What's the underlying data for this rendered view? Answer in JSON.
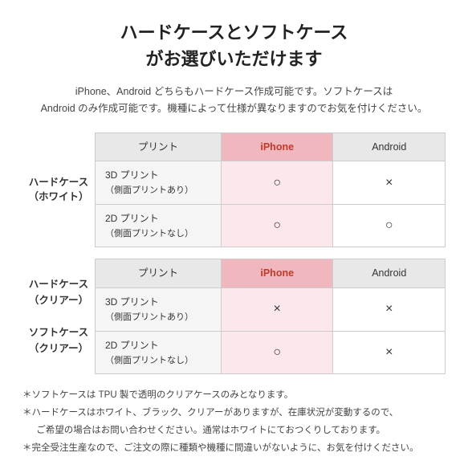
{
  "title_line1": "ハードケースとソフトケース",
  "title_line2": "がお選びいただけます",
  "subtitle": "iPhone、Android どちらもハードケース作成可能です。ソフトケースは\nAndroid のみ作成可能です。機種によって仕様が異なりますのでお気を付けください。",
  "section1": {
    "label_line1": "ハードケース",
    "label_line2": "（ホワイト）",
    "header": {
      "col1": "プリント",
      "col2": "iPhone",
      "col3": "Android"
    },
    "rows": [
      {
        "print": "3D プリント\n（側面プリントあり）",
        "iphone": "○",
        "android": "×"
      },
      {
        "print": "2D プリント\n（側面プリントなし）",
        "iphone": "○",
        "android": "○"
      }
    ]
  },
  "section2": {
    "label_line1": "ハードケース",
    "label_line2": "（クリアー）",
    "label_line3": "ソフトケース",
    "label_line4": "（クリアー）",
    "header": {
      "col1": "プリント",
      "col2": "iPhone",
      "col3": "Android"
    },
    "rows": [
      {
        "print": "3D プリント\n（側面プリントあり）",
        "iphone": "×",
        "android": "×"
      },
      {
        "print": "2D プリント\n（側面プリントなし）",
        "iphone": "○",
        "android": "×"
      }
    ]
  },
  "notes": [
    "＊ソフトケースは TPU 製で透明のクリアケースのみとなります。",
    "＊ハードケースはホワイト、ブラック、クリアーがありますが、在庫状況が変動するので、\nご希望の場合はお問い合わせください。通常はホワイトにておつくりしております。",
    "＊完全受注生産なので、ご注文の際に種類や機種に間違いがないように、お気を付けください。"
  ]
}
